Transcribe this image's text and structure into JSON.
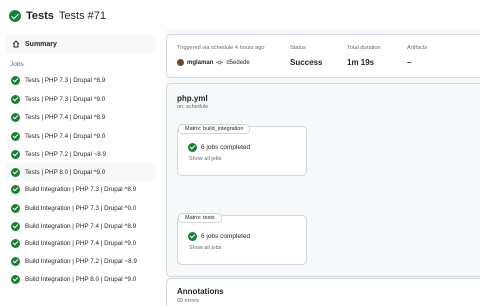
{
  "header": {
    "workflow": "Tests",
    "run": "Tests #71"
  },
  "sidebar": {
    "summary_label": "Summary",
    "jobs_label": "Jobs",
    "jobs": [
      {
        "label": "Tests | PHP 7.3 | Drupal ^8.9"
      },
      {
        "label": "Tests | PHP 7.3 | Drupal ^9.0"
      },
      {
        "label": "Tests | PHP 7.4 | Drupal ^8.9"
      },
      {
        "label": "Tests | PHP 7.4 | Drupal ^9.0"
      },
      {
        "label": "Tests | PHP 7.2 | Drupal ~8.9"
      },
      {
        "label": "Tests | PHP 8.0 | Drupal ^9.0"
      },
      {
        "label": "Build Integration | PHP 7.3 | Drupal ^8.9"
      },
      {
        "label": "Build Integration | PHP 7.3 | Drupal ^9.0"
      },
      {
        "label": "Build Integration | PHP 7.4 | Drupal ^8.9"
      },
      {
        "label": "Build Integration | PHP 7.4 | Drupal ^9.0"
      },
      {
        "label": "Build Integration | PHP 7.2 | Drupal ~8.9"
      },
      {
        "label": "Build Integration | PHP 8.0 | Drupal ^9.0"
      }
    ]
  },
  "summary": {
    "trigger_label": "Triggered via schedule 4 hours ago",
    "actor": "mglaman",
    "commit": "d5edede",
    "status_label": "Status",
    "status_value": "Success",
    "duration_label": "Total duration",
    "duration_value": "1m 19s",
    "artifacts_label": "Artifacts",
    "artifacts_value": "–"
  },
  "graph": {
    "title": "php.yml",
    "subtitle": "on: schedule",
    "matrices": [
      {
        "header": "Matrix: build_integration",
        "status": "6 jobs completed",
        "link": "Show all jobs"
      },
      {
        "header": "Matrix: tests",
        "status": "6 jobs completed",
        "link": "Show all jobs"
      }
    ]
  },
  "annotations": {
    "title": "Annotations",
    "count": "60 errors"
  },
  "colors": {
    "success": "#1a7f37",
    "border": "#d0d7de",
    "muted": "#656d76",
    "panel_bg": "#f6f8fa"
  }
}
